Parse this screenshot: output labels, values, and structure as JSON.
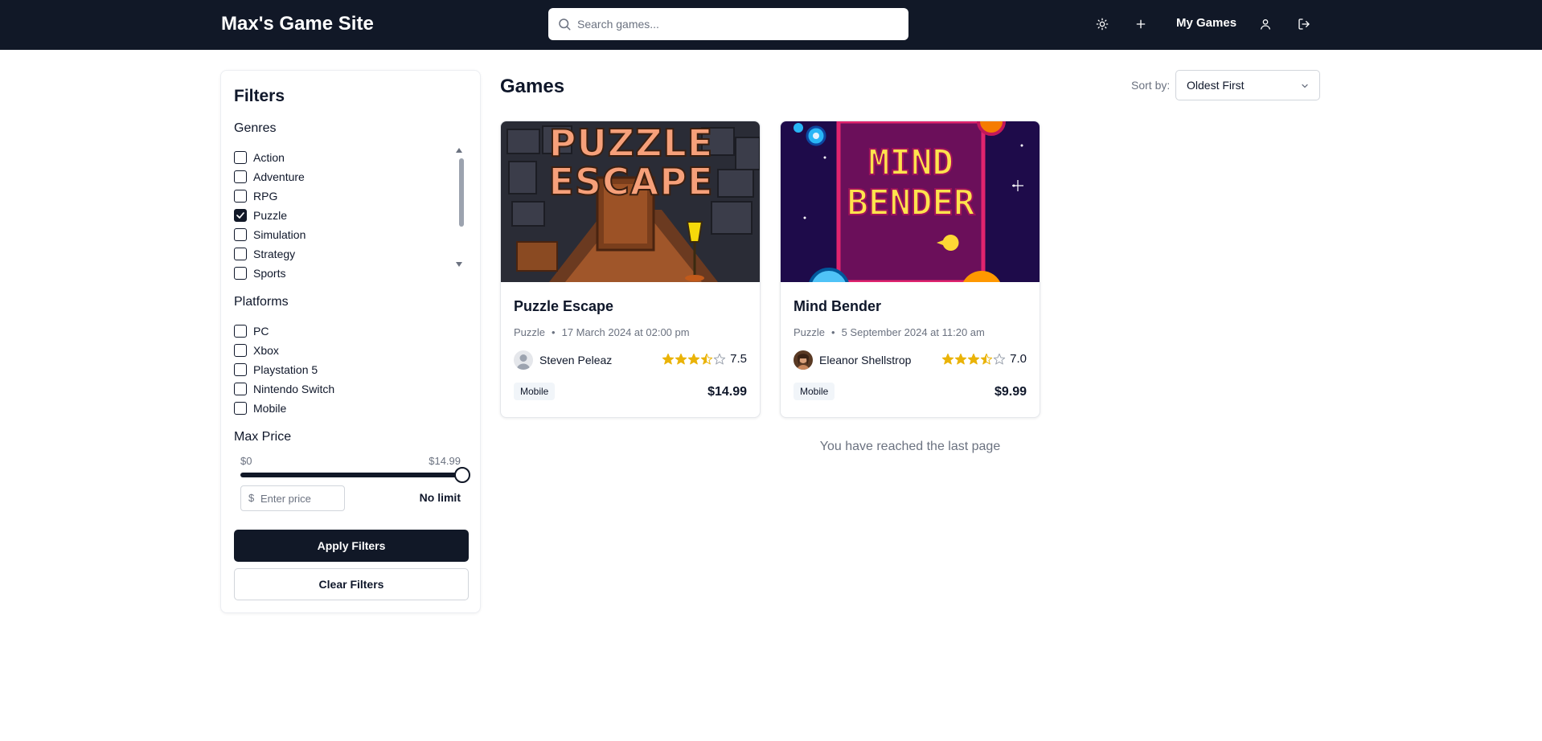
{
  "header": {
    "brand": "Max's Game Site",
    "search_placeholder": "Search games...",
    "my_games": "My Games",
    "icons": [
      "sun-icon",
      "plus-icon",
      "user-icon",
      "logout-icon"
    ]
  },
  "filters": {
    "title": "Filters",
    "genres_title": "Genres",
    "genres": [
      {
        "label": "Action",
        "checked": false
      },
      {
        "label": "Adventure",
        "checked": false
      },
      {
        "label": "RPG",
        "checked": false
      },
      {
        "label": "Puzzle",
        "checked": true
      },
      {
        "label": "Simulation",
        "checked": false
      },
      {
        "label": "Strategy",
        "checked": false
      },
      {
        "label": "Sports",
        "checked": false
      }
    ],
    "platforms_title": "Platforms",
    "platforms": [
      {
        "label": "PC",
        "checked": false
      },
      {
        "label": "Xbox",
        "checked": false
      },
      {
        "label": "Playstation 5",
        "checked": false
      },
      {
        "label": "Nintendo Switch",
        "checked": false
      },
      {
        "label": "Mobile",
        "checked": false
      }
    ],
    "max_price_title": "Max Price",
    "price_min": "$0",
    "price_max": "$14.99",
    "slider_fraction": 1.0,
    "currency": "$",
    "price_placeholder": "Enter price",
    "no_limit": "No limit",
    "apply": "Apply Filters",
    "clear": "Clear Filters"
  },
  "main": {
    "title": "Games",
    "sort_label": "Sort by:",
    "sort_value": "Oldest First",
    "games": [
      {
        "title": "Puzzle Escape",
        "genre": "Puzzle",
        "date": "17 March 2024 at 02:00 pm",
        "author": "Steven Peleaz",
        "rating": "7.5",
        "stars": 3.5,
        "platform": "Mobile",
        "price": "$14.99",
        "cover_text": [
          "PUZZLE",
          "ESCAPE"
        ]
      },
      {
        "title": "Mind Bender",
        "genre": "Puzzle",
        "date": "5 September 2024 at 11:20 am",
        "author": "Eleanor Shellstrop",
        "rating": "7.0",
        "stars": 3.5,
        "platform": "Mobile",
        "price": "$9.99",
        "cover_text": [
          "MIND",
          "BENDER"
        ]
      }
    ],
    "last_page": "You have reached the last page"
  },
  "colors": {
    "header_bg": "#111827",
    "accent_star": "#eab308",
    "muted": "#6b7280"
  }
}
